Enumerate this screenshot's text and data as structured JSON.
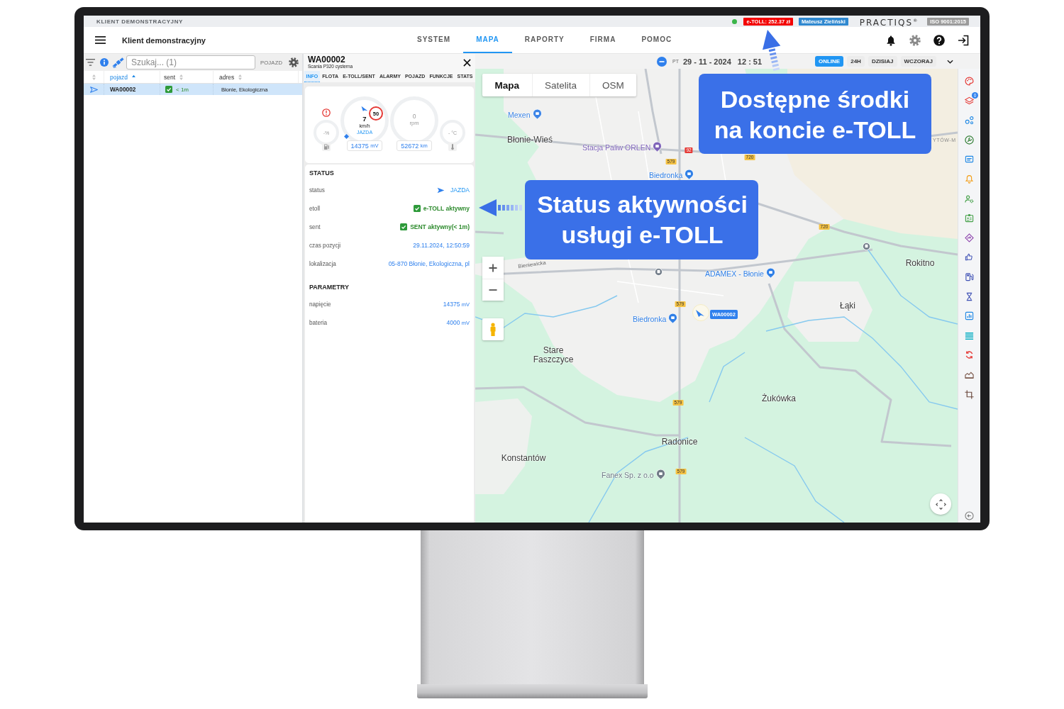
{
  "top_strip": {
    "client": "KLIENT DEMONSTRACYJNY",
    "online": true,
    "etoll_balance": "e-TOLL: 252.37 zł",
    "user": "Mateusz Zieliński",
    "logo": "PRACTIQS$^{®}$",
    "certificate": "ISO 9001:2015"
  },
  "header": {
    "title": "Klient demonstracyjny",
    "tabs": [
      {
        "label": "SYSTEM",
        "selected": false
      },
      {
        "label": "MAPA",
        "selected": true
      },
      {
        "label": "RAPORTY",
        "selected": false
      },
      {
        "label": "FIRMA",
        "selected": false
      },
      {
        "label": "POMOC",
        "selected": false
      }
    ]
  },
  "vehicle_list": {
    "search": {
      "placeholder": "Szukaj... (1)"
    },
    "mode": "POJAZD",
    "columns": [
      {
        "label": "pojazd",
        "sorted": true
      },
      {
        "label": "sent",
        "sorted": false
      },
      {
        "label": "adres",
        "sorted": false
      }
    ],
    "rows": [
      {
        "selected": true,
        "vehicle": "WA00002",
        "sent_ok": true,
        "sent": "< 1m",
        "address": "Błonie, Ekologiczna"
      }
    ]
  },
  "details": {
    "plate": "WA00002",
    "model": "Scania P320 cysterna",
    "tabs": [
      {
        "label": "INFO",
        "selected": true
      },
      {
        "label": "FLOTA",
        "selected": false
      },
      {
        "label": "E-TOLL/SENT",
        "selected": false
      },
      {
        "label": "ALARMY",
        "selected": false
      },
      {
        "label": "POJAZD",
        "selected": false
      },
      {
        "label": "FUNKCJE",
        "selected": false
      },
      {
        "label": "STATS",
        "selected": false
      }
    ],
    "gauges": {
      "warning": true,
      "fuel": "-%",
      "speed": "7",
      "speed_unit": "km/h",
      "drive_state": "JAZDA",
      "speed_limit": "50",
      "rpm": "0",
      "rpm_unit": "rpm",
      "temperature": "- °C",
      "voltage": {
        "value": "14375",
        "unit": "mV"
      },
      "odometer": {
        "value": "52672",
        "unit": "km"
      }
    },
    "sections": [
      {
        "title": "STATUS",
        "rows": [
          {
            "kind": "state",
            "label": "status",
            "value": "JAZDA"
          },
          {
            "kind": "check",
            "label": "etoll",
            "value": "e-TOLL aktywny",
            "checked": true
          },
          {
            "kind": "check",
            "label": "sent",
            "value": "SENT aktywny(< 1m)",
            "checked": true
          },
          {
            "kind": "text",
            "label": "czas pozycji",
            "value": "29.11.2024, 12:50:59"
          },
          {
            "kind": "text",
            "label": "lokalizacja",
            "value": "05-870 Błonie, Ekologiczna, pl"
          }
        ]
      },
      {
        "title": "PARAMETRY",
        "rows": [
          {
            "kind": "measure",
            "label": "napięcie",
            "value": "14375",
            "unit": "mV"
          },
          {
            "kind": "measure",
            "label": "bateria",
            "value": "4000",
            "unit": "mV"
          }
        ]
      }
    ]
  },
  "timeline": {
    "day": "PT",
    "date": "29 - 11 - 2024",
    "time": "12 : 51",
    "ranges": [
      {
        "label": "ONLINE",
        "selected": true
      },
      {
        "label": "24H",
        "selected": false
      },
      {
        "label": "DZISIAJ",
        "selected": false
      },
      {
        "label": "WCZORAJ",
        "selected": false
      }
    ]
  },
  "map": {
    "types": [
      {
        "label": "Mapa",
        "selected": true
      },
      {
        "label": "Satelita",
        "selected": false
      },
      {
        "label": "OSM",
        "selected": false
      }
    ],
    "labels": [
      {
        "kind": "poi",
        "text": "Mexen",
        "color": "#3d85e6"
      },
      {
        "kind": "place",
        "text": "Błonie-Wieś"
      },
      {
        "kind": "area",
        "text": "YTÓW-M"
      },
      {
        "kind": "poi",
        "text": "Stacja Paliw ORLEN",
        "color": "#7e63b8"
      },
      {
        "kind": "road",
        "text": "92",
        "color": "#e53935"
      },
      {
        "kind": "road",
        "text": "720",
        "color": "#f6c344"
      },
      {
        "kind": "road",
        "text": "579",
        "color": "#f6c344"
      },
      {
        "kind": "poi",
        "text": "Biedronka",
        "color": "#2f7fe6"
      },
      {
        "kind": "road",
        "text": "720",
        "color": "#f6c344"
      },
      {
        "kind": "place",
        "text": "Rokitno"
      },
      {
        "kind": "street",
        "text": "Bieniewicka"
      },
      {
        "kind": "poi",
        "text": "ADAMEX - Błonie",
        "color": "#2f7fe6"
      },
      {
        "kind": "road",
        "text": "579",
        "color": "#f6c344"
      },
      {
        "kind": "place",
        "text": "Łąki"
      },
      {
        "kind": "poi",
        "text": "Biedronka",
        "color": "#2f7fe6"
      },
      {
        "kind": "place",
        "text": "Stare Faszczyce"
      },
      {
        "kind": "place",
        "text": "Żukówka"
      },
      {
        "kind": "road",
        "text": "579",
        "color": "#f6c344"
      },
      {
        "kind": "place",
        "text": "Radonice"
      },
      {
        "kind": "place",
        "text": "Konstantów"
      },
      {
        "kind": "road",
        "text": "579",
        "color": "#f6c344"
      },
      {
        "kind": "poi",
        "text": "Fanex Sp. z o.o",
        "color": "#6f7a86"
      }
    ],
    "vehicle": {
      "label": "WA00002"
    }
  },
  "tools": {
    "badge": "0"
  },
  "callouts": [
    {
      "kind": "up",
      "lines": [
        "Dostępne środki",
        "na koncie e-TOLL"
      ]
    },
    {
      "kind": "left",
      "lines": [
        "Status aktywności",
        "usługi e-TOLL"
      ]
    }
  ]
}
